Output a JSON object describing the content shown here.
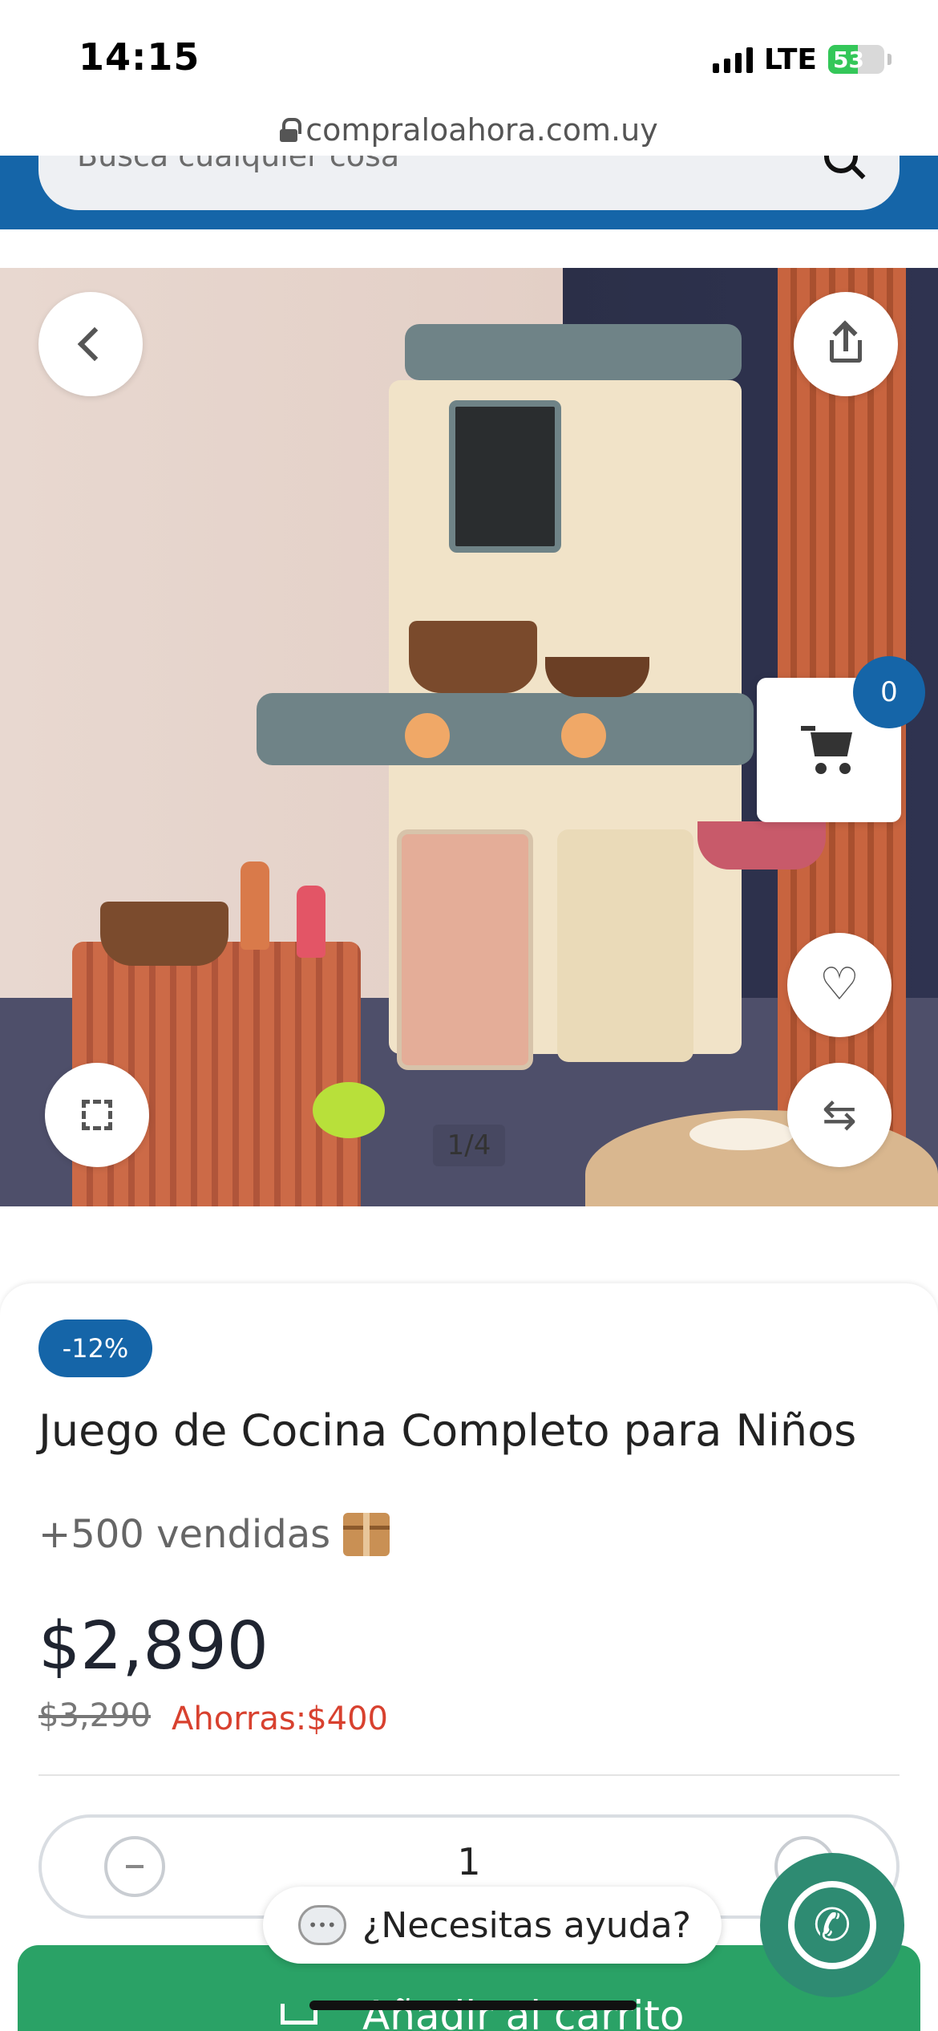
{
  "status_bar": {
    "time": "14:15",
    "network": "LTE",
    "battery": "53"
  },
  "browser": {
    "url": "compraloahora.com.uy"
  },
  "search": {
    "placeholder": "Busca cualquier cosa"
  },
  "gallery": {
    "counter": "1/4"
  },
  "cart": {
    "count": "0"
  },
  "product": {
    "discount": "-12%",
    "title": "Juego de Cocina Completo para Niños",
    "sold": "+500 vendidas",
    "price": "$2,890",
    "old_price": "$3,290",
    "savings": "Ahorras:$400",
    "quantity": "1"
  },
  "actions": {
    "add_to_cart": "Añadir al carrito",
    "help": "¿Necesitas ayuda?"
  },
  "icons": {
    "back": "chevron-left-icon",
    "share": "share-icon",
    "expand": "expand-icon",
    "favorite": "heart-icon",
    "compare": "swap-icon",
    "cart": "cart-icon",
    "whatsapp": "whatsapp-icon",
    "help": "chat-icon",
    "sold": "box-icon"
  },
  "colors": {
    "brand": "#1565a8",
    "add_to_cart": "#2aa266",
    "savings": "#d8412f",
    "whatsapp": "#2e8b72"
  }
}
